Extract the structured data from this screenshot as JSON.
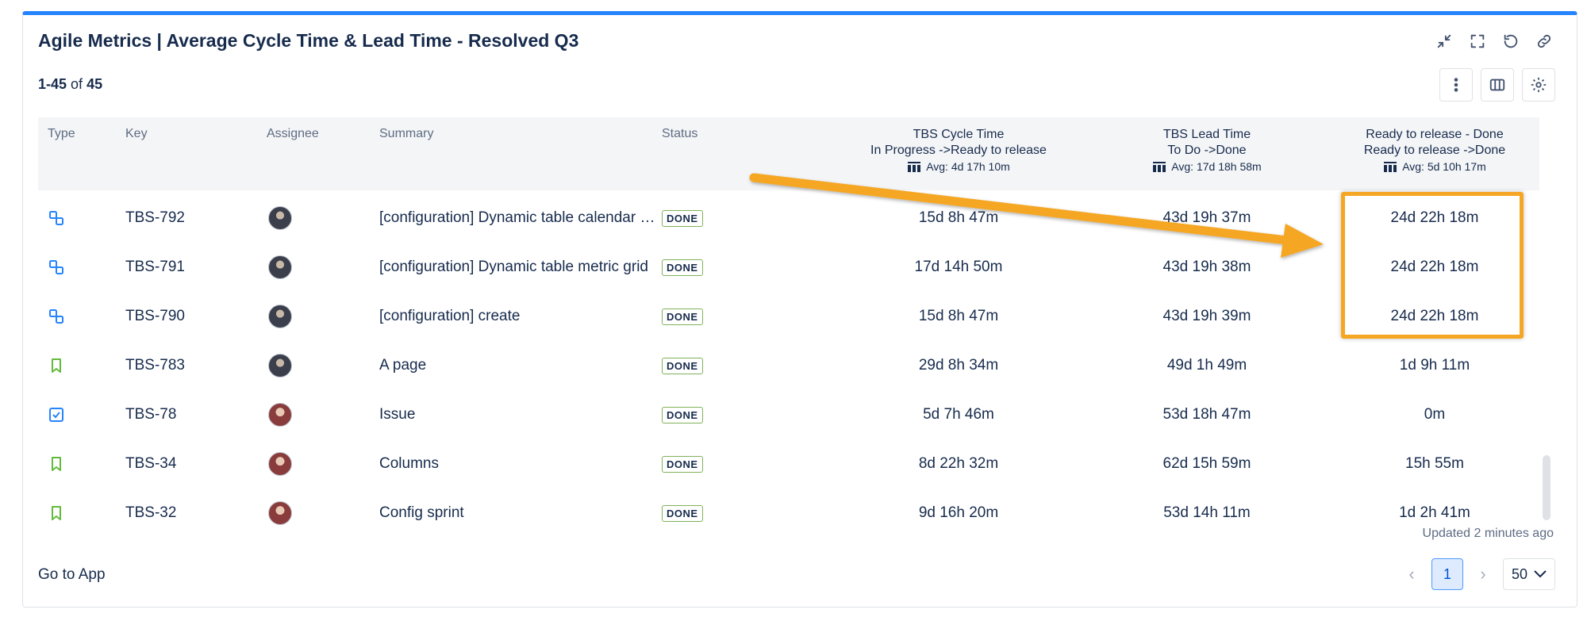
{
  "header": {
    "title": "Agile Metrics | Average Cycle Time & Lead Time - Resolved Q3",
    "count_range": "1-45",
    "count_of": "of",
    "count_total": "45"
  },
  "table": {
    "columns": {
      "type": "Type",
      "key": "Key",
      "assignee": "Assignee",
      "summary": "Summary",
      "status": "Status",
      "cycle_title": "TBS Cycle Time",
      "cycle_sub": "In Progress ->Ready to release",
      "cycle_avg": "Avg: 4d 17h 10m",
      "lead_title": "TBS Lead Time",
      "lead_sub": "To Do ->Done",
      "lead_avg": "Avg: 17d 18h 58m",
      "rtr_title": "Ready to release - Done",
      "rtr_sub": "Ready to release ->Done",
      "rtr_avg": "Avg: 5d 10h 17m"
    },
    "rows": [
      {
        "type": "subtask-icon",
        "key": "TBS-792",
        "summary": "[configuration] Dynamic table calendar …",
        "status": "DONE",
        "cycle": "15d 8h 47m",
        "lead": "43d 19h 37m",
        "rtr": "24d 22h 18m"
      },
      {
        "type": "subtask-icon",
        "key": "TBS-791",
        "summary": "[configuration] Dynamic table metric grid",
        "status": "DONE",
        "cycle": "17d 14h 50m",
        "lead": "43d 19h 38m",
        "rtr": "24d 22h 18m"
      },
      {
        "type": "subtask-icon",
        "key": "TBS-790",
        "summary": "[configuration] create",
        "status": "DONE",
        "cycle": "15d 8h 47m",
        "lead": "43d 19h 39m",
        "rtr": "24d 22h 18m"
      },
      {
        "type": "story-icon",
        "key": "TBS-783",
        "summary": "A page",
        "status": "DONE",
        "cycle": "29d 8h 34m",
        "lead": "49d 1h 49m",
        "rtr": "1d 9h 11m"
      },
      {
        "type": "task-icon",
        "key": "TBS-78",
        "summary": "Issue",
        "status": "DONE",
        "cycle": "5d 7h 46m",
        "lead": "53d 18h 47m",
        "rtr": "0m"
      },
      {
        "type": "story-icon",
        "key": "TBS-34",
        "summary": "Columns",
        "status": "DONE",
        "cycle": "8d 22h 32m",
        "lead": "62d 15h 59m",
        "rtr": "15h 55m"
      },
      {
        "type": "story-icon",
        "key": "TBS-32",
        "summary": "Config sprint",
        "status": "DONE",
        "cycle": "9d 16h 20m",
        "lead": "53d 14h 11m",
        "rtr": "1d 2h 41m"
      }
    ]
  },
  "footer": {
    "updated": "Updated 2 minutes ago",
    "goto": "Go to App",
    "page": "1",
    "page_size": "50"
  },
  "colors": {
    "accent": "#2684ff",
    "annotation": "#f5a623",
    "done_border": "#7fb25a"
  }
}
